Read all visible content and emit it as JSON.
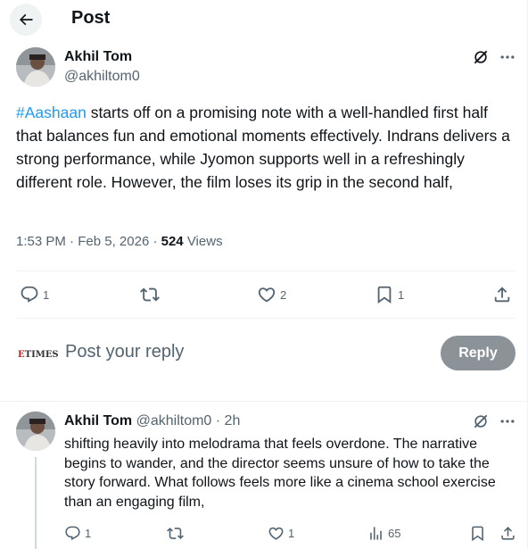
{
  "header": {
    "title": "Post"
  },
  "post": {
    "author_name": "Akhil Tom",
    "author_handle": "@akhiltom0",
    "hashtag": "#Aashaan",
    "text_rest": " starts off on a promising note with a well-handled first half that balances fun and emotional moments effectively. Indrans delivers a strong performance, while Jyomon supports well in a refreshingly different role. However, the film loses its grip in the second half,",
    "time": "1:53 PM",
    "date": "Feb 5, 2026",
    "views_count": "524",
    "views_label": "Views",
    "replies": "1",
    "likes": "2",
    "bookmarks": "1"
  },
  "compose": {
    "logo_text": "TIMES",
    "logo_prefix": "E",
    "placeholder": "Post your reply",
    "button_label": "Reply"
  },
  "reply": {
    "author_name": "Akhil Tom",
    "author_handle": "@akhiltom0",
    "time": "2h",
    "text": "shifting heavily into melodrama that feels overdone. The narrative begins to wander, and the director seems unsure of how to take the story forward. What follows feels more like a cinema school exercise than an engaging film,",
    "replies": "1",
    "likes": "1",
    "views": "65"
  },
  "colors": {
    "accent": "#1d9bf0",
    "muted": "#536471",
    "text": "#0f1419",
    "divider": "#eff3f4",
    "reply_button": "#8b9298"
  },
  "icons": [
    "back-arrow-icon",
    "grok-icon",
    "more-icon",
    "reply-icon",
    "repost-icon",
    "like-icon",
    "bookmark-icon",
    "share-icon",
    "views-icon"
  ]
}
